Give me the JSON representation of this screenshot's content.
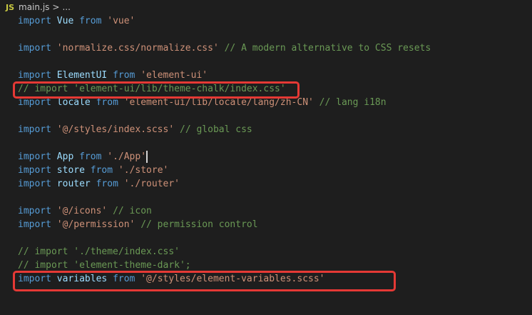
{
  "breadcrumb": {
    "icon": "JS",
    "file": "main.js",
    "separator": ">",
    "more": "..."
  },
  "lines": [
    [
      [
        "kw",
        "import "
      ],
      [
        "id",
        "Vue"
      ],
      [
        "kw",
        " from "
      ],
      [
        "str",
        "'vue'"
      ]
    ],
    [],
    [
      [
        "kw",
        "import "
      ],
      [
        "str",
        "'normalize.css/normalize.css'"
      ],
      [
        "cm",
        " // A modern alternative to CSS resets"
      ]
    ],
    [],
    [
      [
        "kw",
        "import "
      ],
      [
        "id",
        "ElementUI"
      ],
      [
        "kw",
        " from "
      ],
      [
        "str",
        "'element-ui'"
      ]
    ],
    [
      [
        "cm",
        "// import 'element-ui/lib/theme-chalk/index.css'"
      ]
    ],
    [
      [
        "kw",
        "import "
      ],
      [
        "id",
        "locale"
      ],
      [
        "kw",
        " from "
      ],
      [
        "str",
        "'element-ui/lib/locale/lang/zh-CN'"
      ],
      [
        "cm",
        " // lang i18n"
      ]
    ],
    [],
    [
      [
        "kw",
        "import "
      ],
      [
        "str",
        "'@/styles/index.scss'"
      ],
      [
        "cm",
        " // global css"
      ]
    ],
    [],
    [
      [
        "kw",
        "import "
      ],
      [
        "id",
        "App"
      ],
      [
        "kw",
        " from "
      ],
      [
        "str",
        "'./App'"
      ]
    ],
    [
      [
        "kw",
        "import "
      ],
      [
        "id",
        "store"
      ],
      [
        "kw",
        " from "
      ],
      [
        "str",
        "'./store'"
      ]
    ],
    [
      [
        "kw",
        "import "
      ],
      [
        "id",
        "router"
      ],
      [
        "kw",
        " from "
      ],
      [
        "str",
        "'./router'"
      ]
    ],
    [],
    [
      [
        "kw",
        "import "
      ],
      [
        "str",
        "'@/icons'"
      ],
      [
        "cm",
        " // icon"
      ]
    ],
    [
      [
        "kw",
        "import "
      ],
      [
        "str",
        "'@/permission'"
      ],
      [
        "cm",
        " // permission control"
      ]
    ],
    [],
    [
      [
        "cm",
        "// import './theme/index.css'"
      ]
    ],
    [
      [
        "cm",
        "// import 'element-theme-dark';"
      ]
    ],
    [
      [
        "kw",
        "import "
      ],
      [
        "id",
        "variables"
      ],
      [
        "kw",
        " from "
      ],
      [
        "str",
        "'@/styles/element-variables.scss'"
      ]
    ]
  ],
  "colors": {
    "keyword": "#569cd6",
    "identifier": "#9cdcfe",
    "string": "#ce9178",
    "comment": "#6a9955",
    "background": "#1e1e1e",
    "annotation": "#e53935"
  }
}
